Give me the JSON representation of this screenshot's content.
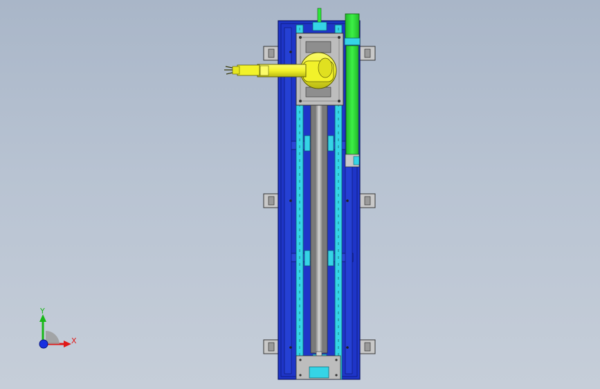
{
  "viewport": {
    "background_top": "#a9b6c8",
    "background_bottom": "#c6ced9"
  },
  "model": {
    "colors": {
      "frame_blue": "#1e35c8",
      "frame_dark": "#0d1a7a",
      "rail_cyan": "#35d4e6",
      "carriage_gray": "#bdbdbd",
      "robot_yellow": "#f2f22a",
      "motor_green": "#2fe63a",
      "bracket_gray": "#c8c8c8"
    },
    "parts": [
      "base-frame",
      "linear-rails",
      "ball-screw",
      "carriage-plate",
      "robot-arm",
      "servo-motor",
      "mounting-brackets"
    ]
  },
  "triad": {
    "x_label": "X",
    "y_label": "Y",
    "x_color": "#e01818",
    "y_color": "#18b818",
    "z_color": "#1830e0"
  }
}
